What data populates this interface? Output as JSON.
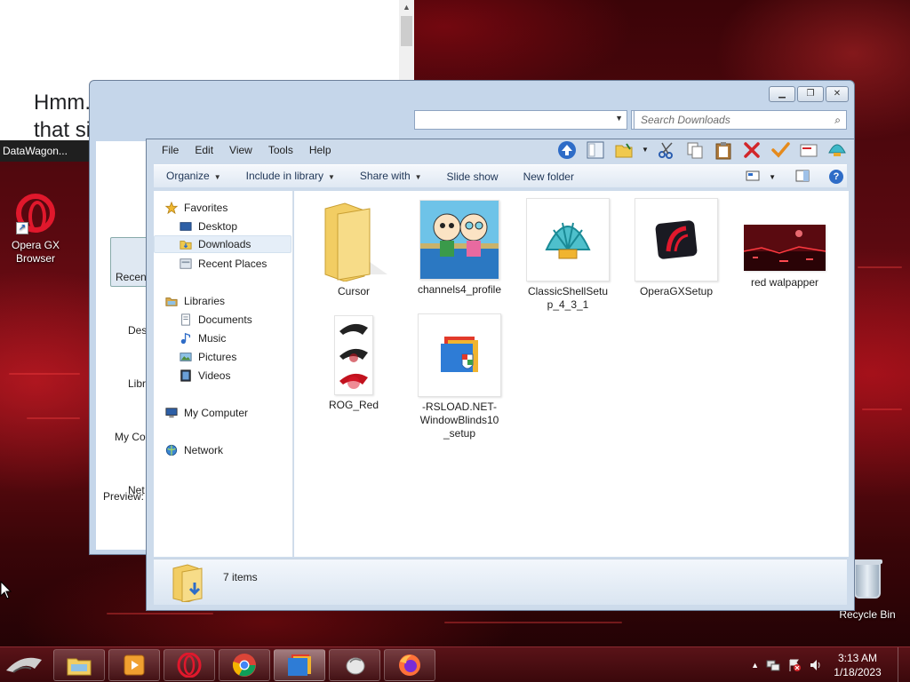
{
  "browser": {
    "error_message": "Hmm. We’re having trouble finding that site."
  },
  "desktop": {
    "datawagon_label": "DataWagon...",
    "icons": [
      {
        "label": "Opera GX Browser"
      },
      {
        "label": "Recycle Bin"
      }
    ]
  },
  "background_window": {
    "search_placeholder": "Search Downloads",
    "left_items": [
      "Recent",
      "Des",
      "Libr",
      "My Co",
      "Net"
    ],
    "preview_label": "Preview:"
  },
  "explorer": {
    "menu": [
      "File",
      "Edit",
      "View",
      "Tools",
      "Help"
    ],
    "commands": {
      "organize": "Organize",
      "include_in_library": "Include in library",
      "share_with": "Share with",
      "slide_show": "Slide show",
      "new_folder": "New folder"
    },
    "nav": {
      "favorites": "Favorites",
      "desktop": "Desktop",
      "downloads": "Downloads",
      "recent_places": "Recent Places",
      "libraries": "Libraries",
      "documents": "Documents",
      "music": "Music",
      "pictures": "Pictures",
      "videos": "Videos",
      "my_computer": "My Computer",
      "network": "Network"
    },
    "files": [
      {
        "name": "Cursor",
        "icon": "folder-icon"
      },
      {
        "name": "channels4_profile",
        "icon": "image-thumbnail"
      },
      {
        "name": "ClassicShellSetup_4_3_1",
        "icon": "shell-icon"
      },
      {
        "name": "OperaGXSetup",
        "icon": "opera-gx-icon"
      },
      {
        "name": "red walpapper",
        "icon": "image-thumbnail"
      },
      {
        "name": "ROG_Red",
        "icon": "rog-icon"
      },
      {
        "name": "-RSLOAD.NET-WindowBlinds10_setup",
        "icon": "installer-icon"
      }
    ],
    "status": "7 items"
  },
  "taskbar": {
    "time": "3:13 AM",
    "date": "1/18/2023"
  },
  "colors": {
    "accent_blue": "#2e6cc7",
    "opera_red": "#e0182c",
    "taskbar": "#4a0d12"
  }
}
